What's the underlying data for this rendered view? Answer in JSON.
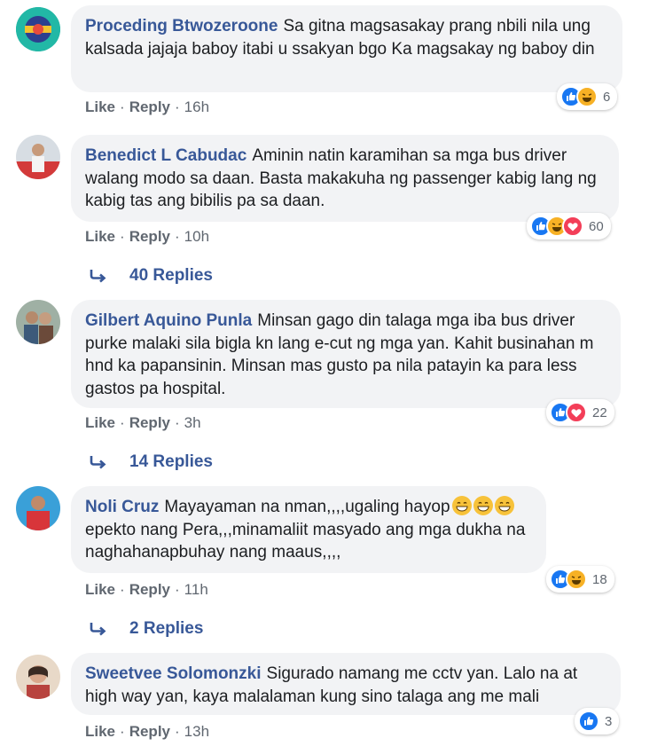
{
  "ui": {
    "like_label": "Like",
    "reply_label": "Reply",
    "separator": "·"
  },
  "comments": [
    {
      "author": "Proceding Btwozeroone",
      "text": "Sa gitna magsasakay prang nbili nila ung kalsada jajaja baboy itabi u ssakyan bgo Ka magsakay ng baboy din",
      "time": "16h",
      "reaction_icons": [
        "like-icon",
        "haha-icon"
      ],
      "reaction_count": "6"
    },
    {
      "author": "Benedict L Cabudac",
      "text": "Aminin natin karamihan sa mga bus driver walang modo sa daan. Basta makakuha ng passenger kabig lang ng kabig tas ang bibilis pa sa daan.",
      "time": "10h",
      "reaction_icons": [
        "like-icon",
        "haha-icon",
        "love-icon"
      ],
      "reaction_count": "60",
      "replies_label": "40 Replies"
    },
    {
      "author": "Gilbert Aquino Punla",
      "text": "Minsan gago din talaga mga iba bus driver purke malaki sila bigla kn lang e-cut ng mga yan. Kahit businahan m hnd ka papansinin. Minsan mas gusto pa nila patayin ka para less gastos pa hospital.",
      "time": "3h",
      "reaction_icons": [
        "like-icon",
        "love-icon"
      ],
      "reaction_count": "22",
      "replies_label": "14 Replies"
    },
    {
      "author": "Noli Cruz",
      "text_line1": "Mayayaman na nman,,,,ugaling hayop",
      "text_emojis": [
        "grin-emoji",
        "grin-emoji",
        "grin-emoji"
      ],
      "text_rest": "epekto nang Pera,,,minamaliit masyado ang mga dukha na naghahanapbuhay nang maaus,,,,",
      "time": "11h",
      "reaction_icons": [
        "like-icon",
        "haha-icon"
      ],
      "reaction_count": "18",
      "replies_label": "2 Replies"
    },
    {
      "author": "Sweetvee Solomonzki",
      "text": "Sigurado namang me cctv yan. Lalo na at high way yan, kaya malalaman kung sino talaga ang me mali",
      "time": "13h",
      "reaction_icons": [
        "like-icon"
      ],
      "reaction_count": "3"
    }
  ]
}
